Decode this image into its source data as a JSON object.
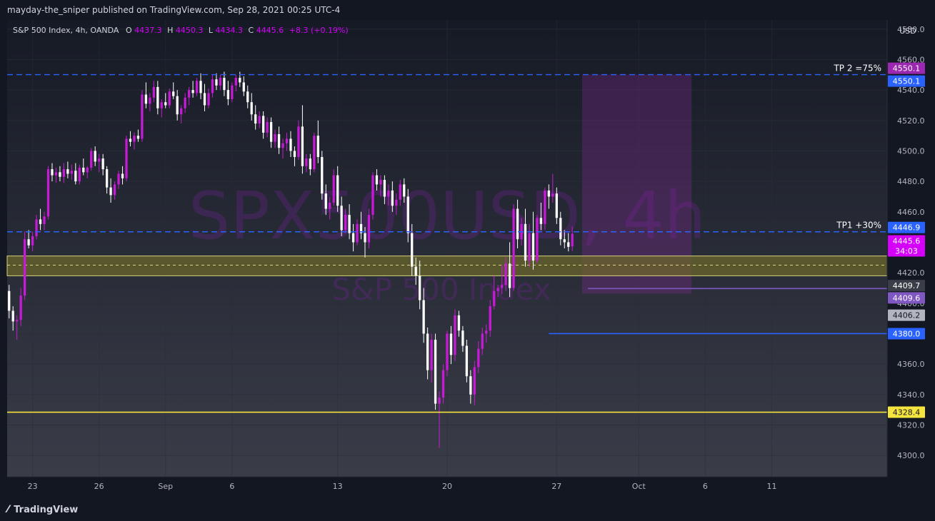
{
  "header": {
    "published": "mayday-the_sniper published on TradingView.com, Sep 28, 2021 00:25 UTC-4"
  },
  "legend": {
    "symbol": "S&P 500 Index, 4h, OANDA",
    "o_label": "O",
    "o": "4437.3",
    "h_label": "H",
    "h": "4450.3",
    "l_label": "L",
    "l": "4434.3",
    "c_label": "C",
    "c": "4445.6",
    "change": "+8.3 (+0.19%)"
  },
  "watermark": {
    "main": "SPX500USD, 4h",
    "sub": "S&P 500 Index"
  },
  "currency": "USD",
  "footer": {
    "brand": "TradingView"
  },
  "colors": {
    "background": "#131722",
    "bull": "#c71ad6",
    "bear": "#ffffff",
    "dashed_blue": "#2962ff",
    "yellow": "#f5e43d",
    "purple_line": "#7e57c2",
    "blue_line": "#2962ff"
  },
  "chart_data": {
    "type": "candlestick",
    "ylim": [
      4286,
      4586
    ],
    "y_ticks": [
      4300,
      4320,
      4340,
      4360,
      4380,
      4400,
      4420,
      4440,
      4460,
      4480,
      4500,
      4520,
      4540,
      4560,
      4580
    ],
    "y_tick_labels": [
      "4300.0",
      "4320.0",
      "4340.0",
      "4360.0",
      "4380.0",
      "4400.0",
      "4420.0",
      "4440.0",
      "4460.0",
      "4480.0",
      "4500.0",
      "4520.0",
      "4540.0",
      "4560.0",
      "4580.0"
    ],
    "x_ticks": [
      {
        "label": "23",
        "bar": 6
      },
      {
        "label": "26",
        "bar": 23
      },
      {
        "label": "Sep",
        "bar": 40
      },
      {
        "label": "6",
        "bar": 57
      },
      {
        "label": "13",
        "bar": 84
      },
      {
        "label": "20",
        "bar": 112
      },
      {
        "label": "27",
        "bar": 140
      },
      {
        "label": "Oct",
        "bar": 161
      },
      {
        "label": "6",
        "bar": 178
      },
      {
        "label": "11",
        "bar": 195
      }
    ],
    "bars_visible": 225,
    "candles": [
      {
        "o": 4408,
        "h": 4412,
        "l": 4390,
        "c": 4395
      },
      {
        "o": 4395,
        "h": 4398,
        "l": 4382,
        "c": 4388
      },
      {
        "o": 4388,
        "h": 4392,
        "l": 4376,
        "c": 4389
      },
      {
        "o": 4389,
        "h": 4410,
        "l": 4385,
        "c": 4405
      },
      {
        "o": 4405,
        "h": 4447,
        "l": 4402,
        "c": 4442
      },
      {
        "o": 4442,
        "h": 4448,
        "l": 4436,
        "c": 4438
      },
      {
        "o": 4438,
        "h": 4447,
        "l": 4434,
        "c": 4444
      },
      {
        "o": 4444,
        "h": 4458,
        "l": 4442,
        "c": 4455
      },
      {
        "o": 4455,
        "h": 4462,
        "l": 4448,
        "c": 4452
      },
      {
        "o": 4452,
        "h": 4460,
        "l": 4448,
        "c": 4457
      },
      {
        "o": 4457,
        "h": 4490,
        "l": 4455,
        "c": 4488
      },
      {
        "o": 4488,
        "h": 4492,
        "l": 4480,
        "c": 4484
      },
      {
        "o": 4484,
        "h": 4489,
        "l": 4479,
        "c": 4486
      },
      {
        "o": 4486,
        "h": 4490,
        "l": 4480,
        "c": 4483
      },
      {
        "o": 4483,
        "h": 4492,
        "l": 4479,
        "c": 4488
      },
      {
        "o": 4488,
        "h": 4493,
        "l": 4482,
        "c": 4485
      },
      {
        "o": 4485,
        "h": 4491,
        "l": 4481,
        "c": 4487
      },
      {
        "o": 4487,
        "h": 4492,
        "l": 4478,
        "c": 4480
      },
      {
        "o": 4480,
        "h": 4491,
        "l": 4478,
        "c": 4489
      },
      {
        "o": 4489,
        "h": 4495,
        "l": 4484,
        "c": 4486
      },
      {
        "o": 4486,
        "h": 4490,
        "l": 4482,
        "c": 4489
      },
      {
        "o": 4489,
        "h": 4502,
        "l": 4487,
        "c": 4500
      },
      {
        "o": 4500,
        "h": 4503,
        "l": 4490,
        "c": 4493
      },
      {
        "o": 4493,
        "h": 4498,
        "l": 4486,
        "c": 4495
      },
      {
        "o": 4495,
        "h": 4498,
        "l": 4484,
        "c": 4488
      },
      {
        "o": 4488,
        "h": 4490,
        "l": 4472,
        "c": 4476
      },
      {
        "o": 4476,
        "h": 4482,
        "l": 4466,
        "c": 4471
      },
      {
        "o": 4471,
        "h": 4480,
        "l": 4468,
        "c": 4478
      },
      {
        "o": 4478,
        "h": 4487,
        "l": 4475,
        "c": 4485
      },
      {
        "o": 4485,
        "h": 4490,
        "l": 4478,
        "c": 4482
      },
      {
        "o": 4482,
        "h": 4510,
        "l": 4480,
        "c": 4508
      },
      {
        "o": 4508,
        "h": 4513,
        "l": 4503,
        "c": 4506
      },
      {
        "o": 4506,
        "h": 4512,
        "l": 4501,
        "c": 4510
      },
      {
        "o": 4510,
        "h": 4514,
        "l": 4506,
        "c": 4508
      },
      {
        "o": 4508,
        "h": 4540,
        "l": 4506,
        "c": 4537
      },
      {
        "o": 4537,
        "h": 4545,
        "l": 4528,
        "c": 4531
      },
      {
        "o": 4531,
        "h": 4538,
        "l": 4526,
        "c": 4535
      },
      {
        "o": 4535,
        "h": 4546,
        "l": 4532,
        "c": 4542
      },
      {
        "o": 4542,
        "h": 4546,
        "l": 4524,
        "c": 4528
      },
      {
        "o": 4528,
        "h": 4534,
        "l": 4522,
        "c": 4532
      },
      {
        "o": 4532,
        "h": 4538,
        "l": 4528,
        "c": 4530
      },
      {
        "o": 4530,
        "h": 4541,
        "l": 4528,
        "c": 4539
      },
      {
        "o": 4539,
        "h": 4545,
        "l": 4534,
        "c": 4536
      },
      {
        "o": 4536,
        "h": 4540,
        "l": 4520,
        "c": 4524
      },
      {
        "o": 4524,
        "h": 4530,
        "l": 4518,
        "c": 4528
      },
      {
        "o": 4528,
        "h": 4538,
        "l": 4525,
        "c": 4535
      },
      {
        "o": 4535,
        "h": 4542,
        "l": 4530,
        "c": 4540
      },
      {
        "o": 4540,
        "h": 4546,
        "l": 4535,
        "c": 4538
      },
      {
        "o": 4538,
        "h": 4548,
        "l": 4536,
        "c": 4546
      },
      {
        "o": 4546,
        "h": 4551,
        "l": 4534,
        "c": 4538
      },
      {
        "o": 4538,
        "h": 4544,
        "l": 4526,
        "c": 4530
      },
      {
        "o": 4530,
        "h": 4541,
        "l": 4528,
        "c": 4538
      },
      {
        "o": 4538,
        "h": 4550,
        "l": 4535,
        "c": 4547
      },
      {
        "o": 4547,
        "h": 4551,
        "l": 4540,
        "c": 4543
      },
      {
        "o": 4543,
        "h": 4550,
        "l": 4540,
        "c": 4548
      },
      {
        "o": 4548,
        "h": 4552,
        "l": 4536,
        "c": 4540
      },
      {
        "o": 4540,
        "h": 4546,
        "l": 4530,
        "c": 4534
      },
      {
        "o": 4534,
        "h": 4545,
        "l": 4532,
        "c": 4543
      },
      {
        "o": 4543,
        "h": 4550,
        "l": 4539,
        "c": 4548
      },
      {
        "o": 4548,
        "h": 4552,
        "l": 4542,
        "c": 4545
      },
      {
        "o": 4545,
        "h": 4549,
        "l": 4536,
        "c": 4539
      },
      {
        "o": 4539,
        "h": 4543,
        "l": 4528,
        "c": 4532
      },
      {
        "o": 4532,
        "h": 4538,
        "l": 4520,
        "c": 4524
      },
      {
        "o": 4524,
        "h": 4530,
        "l": 4514,
        "c": 4518
      },
      {
        "o": 4518,
        "h": 4526,
        "l": 4515,
        "c": 4523
      },
      {
        "o": 4523,
        "h": 4526,
        "l": 4508,
        "c": 4512
      },
      {
        "o": 4512,
        "h": 4522,
        "l": 4509,
        "c": 4519
      },
      {
        "o": 4519,
        "h": 4522,
        "l": 4502,
        "c": 4506
      },
      {
        "o": 4506,
        "h": 4514,
        "l": 4502,
        "c": 4511
      },
      {
        "o": 4511,
        "h": 4516,
        "l": 4498,
        "c": 4502
      },
      {
        "o": 4502,
        "h": 4508,
        "l": 4495,
        "c": 4505
      },
      {
        "o": 4505,
        "h": 4512,
        "l": 4500,
        "c": 4508
      },
      {
        "o": 4508,
        "h": 4513,
        "l": 4496,
        "c": 4500
      },
      {
        "o": 4500,
        "h": 4503,
        "l": 4490,
        "c": 4496
      },
      {
        "o": 4496,
        "h": 4520,
        "l": 4494,
        "c": 4516
      },
      {
        "o": 4516,
        "h": 4530,
        "l": 4485,
        "c": 4490
      },
      {
        "o": 4490,
        "h": 4498,
        "l": 4486,
        "c": 4495
      },
      {
        "o": 4495,
        "h": 4498,
        "l": 4484,
        "c": 4488
      },
      {
        "o": 4488,
        "h": 4512,
        "l": 4486,
        "c": 4510
      },
      {
        "o": 4510,
        "h": 4520,
        "l": 4492,
        "c": 4496
      },
      {
        "o": 4496,
        "h": 4500,
        "l": 4468,
        "c": 4472
      },
      {
        "o": 4472,
        "h": 4478,
        "l": 4458,
        "c": 4462
      },
      {
        "o": 4462,
        "h": 4470,
        "l": 4455,
        "c": 4466
      },
      {
        "o": 4466,
        "h": 4488,
        "l": 4464,
        "c": 4484
      },
      {
        "o": 4484,
        "h": 4490,
        "l": 4460,
        "c": 4464
      },
      {
        "o": 4464,
        "h": 4470,
        "l": 4444,
        "c": 4448
      },
      {
        "o": 4448,
        "h": 4462,
        "l": 4446,
        "c": 4458
      },
      {
        "o": 4458,
        "h": 4465,
        "l": 4442,
        "c": 4446
      },
      {
        "o": 4446,
        "h": 4452,
        "l": 4434,
        "c": 4440
      },
      {
        "o": 4440,
        "h": 4455,
        "l": 4438,
        "c": 4452
      },
      {
        "o": 4452,
        "h": 4460,
        "l": 4442,
        "c": 4446
      },
      {
        "o": 4446,
        "h": 4450,
        "l": 4430,
        "c": 4440
      },
      {
        "o": 4440,
        "h": 4462,
        "l": 4436,
        "c": 4458
      },
      {
        "o": 4458,
        "h": 4486,
        "l": 4455,
        "c": 4484
      },
      {
        "o": 4484,
        "h": 4488,
        "l": 4474,
        "c": 4478
      },
      {
        "o": 4478,
        "h": 4484,
        "l": 4470,
        "c": 4481
      },
      {
        "o": 4481,
        "h": 4484,
        "l": 4465,
        "c": 4470
      },
      {
        "o": 4470,
        "h": 4478,
        "l": 4464,
        "c": 4474
      },
      {
        "o": 4474,
        "h": 4480,
        "l": 4460,
        "c": 4464
      },
      {
        "o": 4464,
        "h": 4472,
        "l": 4458,
        "c": 4468
      },
      {
        "o": 4468,
        "h": 4481,
        "l": 4464,
        "c": 4478
      },
      {
        "o": 4478,
        "h": 4482,
        "l": 4466,
        "c": 4470
      },
      {
        "o": 4470,
        "h": 4475,
        "l": 4440,
        "c": 4446
      },
      {
        "o": 4446,
        "h": 4452,
        "l": 4418,
        "c": 4424
      },
      {
        "o": 4424,
        "h": 4430,
        "l": 4412,
        "c": 4418
      },
      {
        "o": 4418,
        "h": 4428,
        "l": 4396,
        "c": 4402
      },
      {
        "o": 4402,
        "h": 4410,
        "l": 4374,
        "c": 4380
      },
      {
        "o": 4380,
        "h": 4384,
        "l": 4350,
        "c": 4356
      },
      {
        "o": 4356,
        "h": 4380,
        "l": 4348,
        "c": 4376
      },
      {
        "o": 4376,
        "h": 4380,
        "l": 4330,
        "c": 4334
      },
      {
        "o": 4334,
        "h": 4342,
        "l": 4305,
        "c": 4338
      },
      {
        "o": 4338,
        "h": 4360,
        "l": 4334,
        "c": 4356
      },
      {
        "o": 4356,
        "h": 4382,
        "l": 4352,
        "c": 4380
      },
      {
        "o": 4380,
        "h": 4385,
        "l": 4360,
        "c": 4366
      },
      {
        "o": 4366,
        "h": 4396,
        "l": 4362,
        "c": 4392
      },
      {
        "o": 4392,
        "h": 4395,
        "l": 4378,
        "c": 4382
      },
      {
        "o": 4382,
        "h": 4385,
        "l": 4368,
        "c": 4372
      },
      {
        "o": 4372,
        "h": 4376,
        "l": 4348,
        "c": 4352
      },
      {
        "o": 4352,
        "h": 4356,
        "l": 4334,
        "c": 4340
      },
      {
        "o": 4340,
        "h": 4362,
        "l": 4333,
        "c": 4358
      },
      {
        "o": 4358,
        "h": 4375,
        "l": 4354,
        "c": 4370
      },
      {
        "o": 4370,
        "h": 4384,
        "l": 4366,
        "c": 4380
      },
      {
        "o": 4380,
        "h": 4386,
        "l": 4374,
        "c": 4382
      },
      {
        "o": 4382,
        "h": 4402,
        "l": 4378,
        "c": 4398
      },
      {
        "o": 4398,
        "h": 4418,
        "l": 4396,
        "c": 4408
      },
      {
        "o": 4408,
        "h": 4412,
        "l": 4404,
        "c": 4410
      },
      {
        "o": 4410,
        "h": 4425,
        "l": 4406,
        "c": 4412
      },
      {
        "o": 4412,
        "h": 4430,
        "l": 4408,
        "c": 4426
      },
      {
        "o": 4426,
        "h": 4440,
        "l": 4404,
        "c": 4410
      },
      {
        "o": 4410,
        "h": 4465,
        "l": 4408,
        "c": 4462
      },
      {
        "o": 4462,
        "h": 4468,
        "l": 4436,
        "c": 4442
      },
      {
        "o": 4442,
        "h": 4456,
        "l": 4438,
        "c": 4452
      },
      {
        "o": 4452,
        "h": 4462,
        "l": 4424,
        "c": 4428
      },
      {
        "o": 4428,
        "h": 4452,
        "l": 4424,
        "c": 4446
      },
      {
        "o": 4446,
        "h": 4460,
        "l": 4422,
        "c": 4428
      },
      {
        "o": 4428,
        "h": 4458,
        "l": 4426,
        "c": 4456
      },
      {
        "o": 4456,
        "h": 4466,
        "l": 4448,
        "c": 4452
      },
      {
        "o": 4452,
        "h": 4476,
        "l": 4448,
        "c": 4474
      },
      {
        "o": 4474,
        "h": 4478,
        "l": 4462,
        "c": 4470
      },
      {
        "o": 4470,
        "h": 4485,
        "l": 4466,
        "c": 4472
      },
      {
        "o": 4472,
        "h": 4476,
        "l": 4452,
        "c": 4456
      },
      {
        "o": 4456,
        "h": 4460,
        "l": 4438,
        "c": 4442
      },
      {
        "o": 4442,
        "h": 4448,
        "l": 4436,
        "c": 4440
      },
      {
        "o": 4440,
        "h": 4446,
        "l": 4434,
        "c": 4437
      },
      {
        "o": 4437.3,
        "h": 4450.3,
        "l": 4434.3,
        "c": 4445.6
      }
    ],
    "levels": [
      {
        "name": "TP 2 =75%",
        "label": "TP 2 =75%",
        "value": 4550.1,
        "style": "dashed",
        "color": "#2962ff"
      },
      {
        "name": "TP1 +30%",
        "label": "TP1 +30%",
        "value": 4446.9,
        "style": "dashed",
        "color": "#2962ff"
      },
      {
        "name": "purple",
        "value": 4409.6,
        "style": "solid",
        "color": "#7e57c2",
        "from_bar": 148
      },
      {
        "name": "blue",
        "value": 4380.0,
        "style": "solid",
        "color": "#2962ff",
        "from_bar": 138
      },
      {
        "name": "yellow",
        "value": 4328.4,
        "style": "solid",
        "color": "#f5e43d"
      }
    ],
    "zone": {
      "top": 4431,
      "bottom": 4418,
      "mid": 4425
    },
    "target_box": {
      "from_bar": 147,
      "to_bar": 175,
      "top": 4550.1,
      "bottom": 4406.2
    },
    "price_tags": [
      {
        "label": "4550.1",
        "value": 4550.1,
        "bg": "#9c27b0",
        "dy": -9
      },
      {
        "label": "4550.1",
        "value": 4550.1,
        "bg": "#2962ff",
        "dy": 9
      },
      {
        "label": "4446.9",
        "value": 4446.9,
        "bg": "#2962ff",
        "dy": -6
      },
      {
        "label": "4445.6",
        "value": 4445.6,
        "bg": "#d500f9",
        "dy": 10
      },
      {
        "label": "34:03",
        "value": 4445.6,
        "bg": "#d500f9",
        "dy": 24
      },
      {
        "label": "4409.7",
        "value": 4409.7,
        "bg": "#3a3e48",
        "dy": -4
      },
      {
        "label": "4409.6",
        "value": 4409.6,
        "bg": "#7e57c2",
        "dy": 13
      },
      {
        "label": "4406.2",
        "value": 4406.2,
        "bg": "#b2b5be",
        "dy": 30,
        "fg": "#131722"
      },
      {
        "label": "4380.0",
        "value": 4380.0,
        "bg": "#2962ff"
      },
      {
        "label": "4328.4",
        "value": 4328.4,
        "bg": "#f5e43d",
        "fg": "#131722"
      }
    ]
  }
}
